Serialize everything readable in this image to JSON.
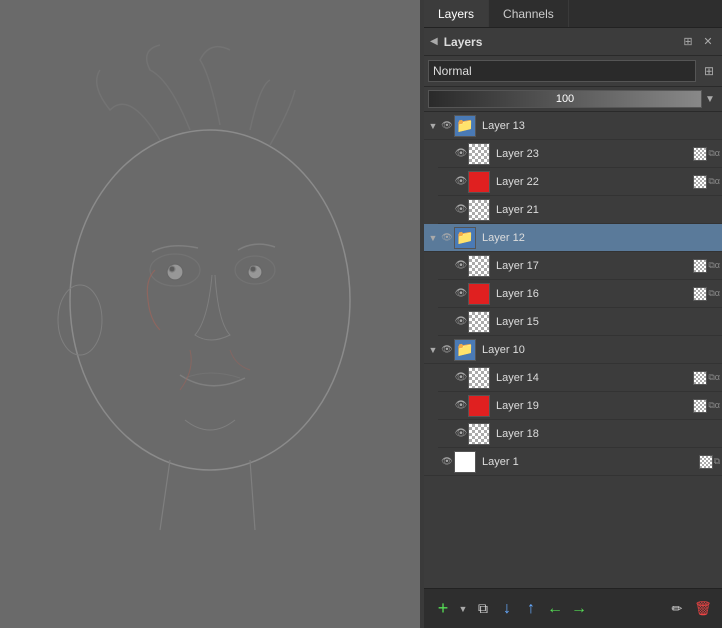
{
  "tabs": [
    {
      "label": "Layers",
      "active": true
    },
    {
      "label": "Channels",
      "active": false
    }
  ],
  "panel": {
    "title": "Layers",
    "blend_mode": "Normal",
    "opacity_value": "100"
  },
  "layers": [
    {
      "id": "layer13",
      "name": "Layer 13",
      "type": "group",
      "indent": 0,
      "expanded": true,
      "selected": false,
      "thumb": "blue-folder",
      "children": [
        {
          "id": "layer23",
          "name": "Layer 23",
          "type": "layer",
          "indent": 1,
          "selected": false,
          "thumb": "checkerboard",
          "has_mini": true
        },
        {
          "id": "layer22",
          "name": "Layer 22",
          "type": "layer",
          "indent": 1,
          "selected": false,
          "thumb": "red-fill",
          "has_mini": true
        },
        {
          "id": "layer21",
          "name": "Layer 21",
          "type": "layer",
          "indent": 1,
          "selected": false,
          "thumb": "checkerboard",
          "has_mini": false
        }
      ]
    },
    {
      "id": "layer12",
      "name": "Layer 12",
      "type": "group",
      "indent": 0,
      "expanded": true,
      "selected": true,
      "thumb": "blue-folder",
      "children": [
        {
          "id": "layer17",
          "name": "Layer 17",
          "type": "layer",
          "indent": 1,
          "selected": false,
          "thumb": "checkerboard",
          "has_mini": true
        },
        {
          "id": "layer16",
          "name": "Layer 16",
          "type": "layer",
          "indent": 1,
          "selected": false,
          "thumb": "red-fill",
          "has_mini": true
        },
        {
          "id": "layer15",
          "name": "Layer 15",
          "type": "layer",
          "indent": 1,
          "selected": false,
          "thumb": "checkerboard",
          "has_mini": false
        }
      ]
    },
    {
      "id": "layer10",
      "name": "Layer 10",
      "type": "group",
      "indent": 0,
      "expanded": true,
      "selected": false,
      "thumb": "blue-folder",
      "children": [
        {
          "id": "layer14",
          "name": "Layer 14",
          "type": "layer",
          "indent": 1,
          "selected": false,
          "thumb": "checkerboard",
          "has_mini": true
        },
        {
          "id": "layer19",
          "name": "Layer 19",
          "type": "layer",
          "indent": 1,
          "selected": false,
          "thumb": "red-fill",
          "has_mini": true
        },
        {
          "id": "layer18",
          "name": "Layer 18",
          "type": "layer",
          "indent": 1,
          "selected": false,
          "thumb": "checkerboard",
          "has_mini": false
        }
      ]
    },
    {
      "id": "layer1",
      "name": "Layer 1",
      "type": "layer",
      "indent": 0,
      "selected": false,
      "thumb": "white-fill",
      "has_mini": true
    }
  ],
  "toolbar": {
    "add_label": "+",
    "duplicate_label": "⧉",
    "down_label": "↓",
    "up_label": "↑",
    "left_label": "←",
    "right_label": "→",
    "pencil_label": "✏",
    "delete_label": "🗑"
  }
}
